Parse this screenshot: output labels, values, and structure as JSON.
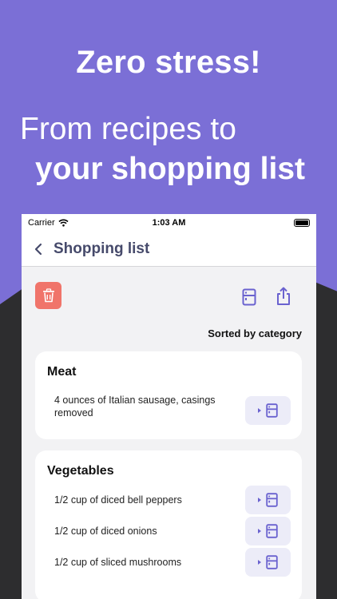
{
  "marketing": {
    "headline": "Zero stress!",
    "subline_1": "From recipes to",
    "subline_2": "your shopping list"
  },
  "statusbar": {
    "carrier": "Carrier",
    "time": "1:03 AM"
  },
  "navbar": {
    "title": "Shopping list"
  },
  "toolbar": {
    "sort_label": "Sorted by category"
  },
  "categories": [
    {
      "title": "Meat",
      "items": [
        "4 ounces of Italian sausage, casings removed"
      ]
    },
    {
      "title": "Vegetables",
      "items": [
        "1/2 cup of diced bell peppers",
        "1/2 cup of diced onions",
        "1/2 cup of sliced mushrooms"
      ]
    }
  ],
  "colors": {
    "background": "#7b6fd6",
    "accent": "#6a62cf",
    "delete": "#f0746a",
    "title_text": "#464a6b"
  },
  "icons": {
    "back": "chevron-left-icon",
    "trash": "trash-icon",
    "fridge": "fridge-icon",
    "share": "share-icon",
    "wifi": "wifi-icon",
    "battery": "battery-icon"
  }
}
